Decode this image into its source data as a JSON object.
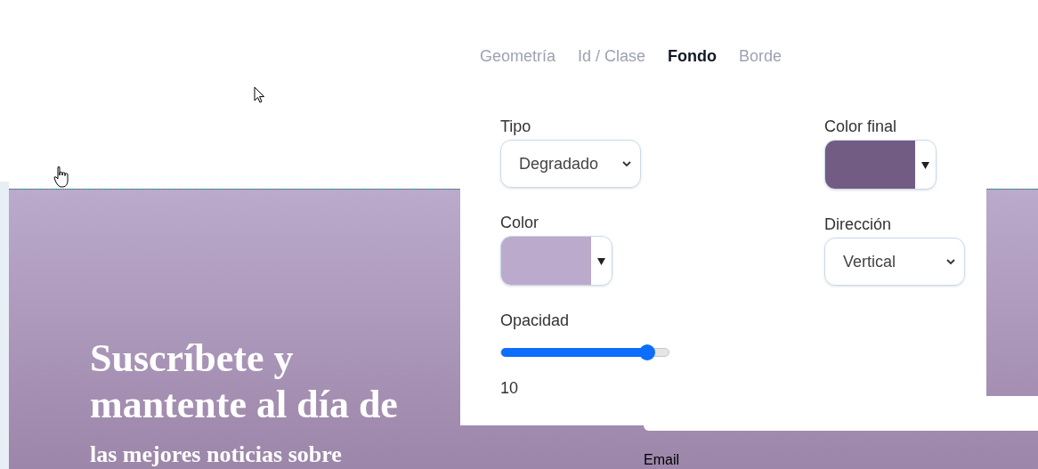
{
  "canvas": {
    "heading": "Suscríbete y mantente al día de",
    "subheading": "las mejores noticias sobre",
    "form_label": "Email"
  },
  "panel": {
    "tabs": [
      {
        "label": "Geometría",
        "selected": false
      },
      {
        "label": "Id / Clase",
        "selected": false
      },
      {
        "label": "Fondo",
        "selected": true
      },
      {
        "label": "Borde",
        "selected": false
      }
    ],
    "left_column": [
      {
        "kind": "select",
        "label": "Tipo",
        "value": "Degradado"
      },
      {
        "kind": "color",
        "label": "Color",
        "color": "#bbaacb"
      },
      {
        "kind": "slider",
        "label": "Opacidad",
        "level": 0.87,
        "reading": "10"
      }
    ],
    "right_column": [
      {
        "kind": "color",
        "label": "Color final",
        "color": "#725c83"
      },
      {
        "kind": "select",
        "label": "Dirección",
        "value": "Vertical"
      }
    ]
  }
}
